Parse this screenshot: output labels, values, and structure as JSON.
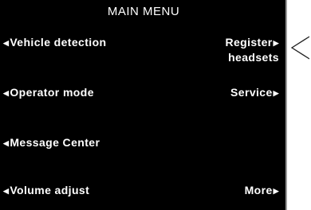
{
  "menu_title": "MAIN MENU",
  "left_items": [
    "Vehicle detection",
    "Operator mode",
    "Message Center",
    "Volume adjust"
  ],
  "right_items": {
    "register_line1": "Register",
    "register_line2": "headsets",
    "service": "Service",
    "more": "More"
  },
  "icons": {
    "left_arrow": "◀",
    "right_arrow": "▶",
    "pointer": "pointer-icon"
  },
  "colors": {
    "screen_background": "#000000",
    "text": "#ffffff",
    "page_background": "#ffffff"
  }
}
